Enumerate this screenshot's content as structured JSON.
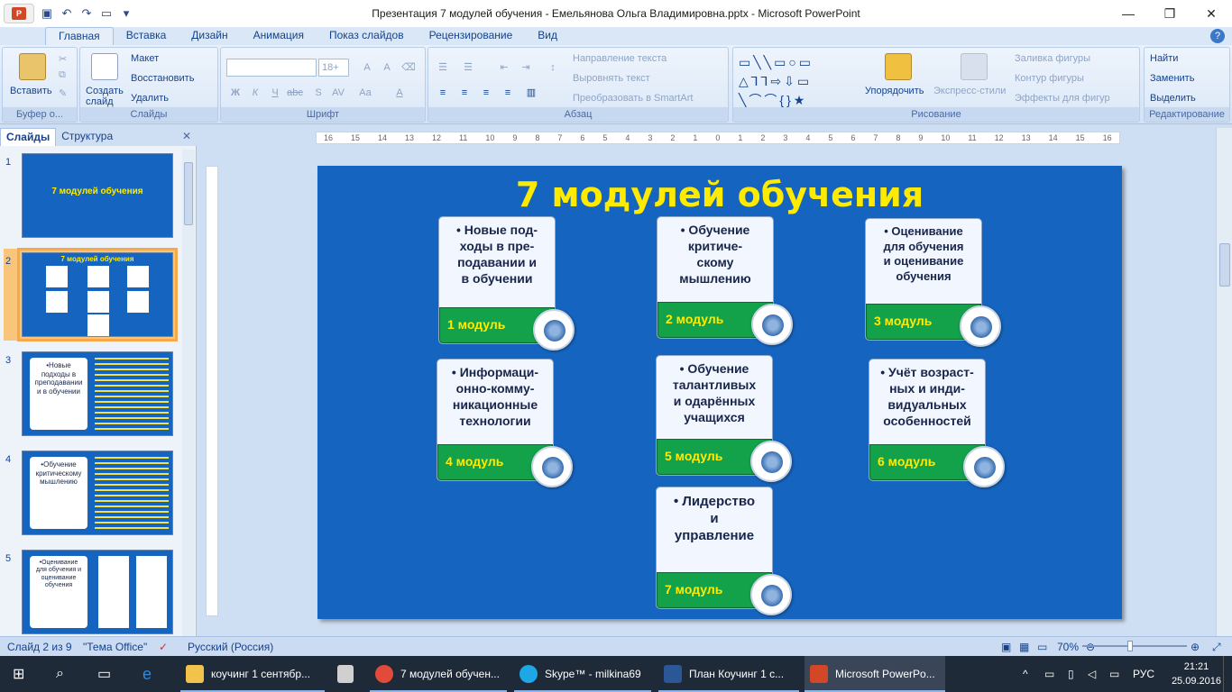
{
  "window": {
    "title": "Презентация 7 модулей обучения - Емельянова Ольга Владимировна.pptx - Microsoft PowerPoint",
    "min_icon": "minimize-icon",
    "max_icon": "restore-icon",
    "close_icon": "close-icon"
  },
  "qat": {
    "save_icon": "save-icon",
    "undo_icon": "undo-icon",
    "redo_icon": "redo-icon",
    "open_icon": "open-icon"
  },
  "ribbon_tabs": [
    "Главная",
    "Вставка",
    "Дизайн",
    "Анимация",
    "Показ слайдов",
    "Рецензирование",
    "Вид"
  ],
  "ribbon": {
    "clipboard": {
      "paste": "Вставить",
      "label": "Буфер о..."
    },
    "slides": {
      "new_slide": "Создать слайд",
      "layout": "Макет",
      "reset": "Восстановить",
      "delete": "Удалить",
      "label": "Слайды"
    },
    "font": {
      "size": "18+",
      "label": "Шрифт",
      "bold": "Ж",
      "italic": "К",
      "underline": "Ч",
      "strike": "abc",
      "shadow": "S",
      "spacing": "AV",
      "case": "Aa",
      "color": "A"
    },
    "paragraph": {
      "direction": "Направление текста",
      "align_text": "Выровнять текст",
      "smartart": "Преобразовать в SmartArt",
      "label": "Абзац"
    },
    "drawing": {
      "arrange": "Упорядочить",
      "quick_styles": "Экспресс-стили",
      "fill": "Заливка фигуры",
      "outline": "Контур фигуры",
      "effects": "Эффекты для фигур",
      "label": "Рисование"
    },
    "editing": {
      "find": "Найти",
      "replace": "Заменить",
      "select": "Выделить",
      "label": "Редактирование"
    }
  },
  "slides_pane": {
    "tab_slides": "Слайды",
    "tab_outline": "Структура",
    "thumbs": [
      {
        "num": "1",
        "title": "7 модулей обучения"
      },
      {
        "num": "2",
        "title": "7 модулей обучения"
      },
      {
        "num": "3",
        "title": "•Новые подходы в преподавании и в обучении"
      },
      {
        "num": "4",
        "title": "•Обучение критическому мышлению"
      },
      {
        "num": "5",
        "title": "•Оценивание для обучения и оценивание обучения"
      }
    ]
  },
  "ruler": {
    "h_labels": [
      "16",
      "15",
      "14",
      "13",
      "12",
      "11",
      "10",
      "9",
      "8",
      "7",
      "6",
      "5",
      "4",
      "3",
      "2",
      "1",
      "0",
      "1",
      "2",
      "3",
      "4",
      "5",
      "6",
      "7",
      "8",
      "9",
      "10",
      "11",
      "12",
      "13",
      "14",
      "15",
      "16"
    ]
  },
  "slide": {
    "title": "7 модулей обучения",
    "cards": [
      {
        "text": "•  Новые под-\nходы в пре-\nподавании и\nв обучении",
        "label": "1 модуль",
        "icon": "people-icon"
      },
      {
        "text": "•  Обучение\nкритиче-\nскому\nмышлению",
        "label": "2 модуль",
        "icon": "puzzle-globe-icon"
      },
      {
        "text": "• Оценивание\nдля обучения\nи оценивание\nобучения",
        "label": "3 модуль",
        "icon": "chart-icon"
      },
      {
        "text": "• Информаци-\nонно-комму-\nникационные\nтехнологии",
        "label": "4 модуль",
        "icon": "computer-user-icon"
      },
      {
        "text": "• Обучение\nталантливых\nи одарённых\nучащихся",
        "label": "5 модуль",
        "icon": "climber-icon"
      },
      {
        "text": "• Учёт возраст-\nных и инди-\nвидуальных\nособенностей",
        "label": "6 модуль",
        "icon": "figures-icon"
      },
      {
        "text": "•  Лидерство\nи\nуправление",
        "label": "7 модуль",
        "icon": "team-icon"
      }
    ]
  },
  "status": {
    "slide": "Слайд 2 из 9",
    "theme": "\"Тема Office\"",
    "lang": "Русский (Россия)",
    "zoom": "70%"
  },
  "taskbar": {
    "items": [
      "коучинг 1 сентябр...",
      "7 модулей обучен...",
      "Skype™ - milkina69",
      "План Коучинг  1 с...",
      "Microsoft PowerPo..."
    ],
    "lang": "РУС",
    "time": "21:21",
    "date": "25.09.2016"
  }
}
